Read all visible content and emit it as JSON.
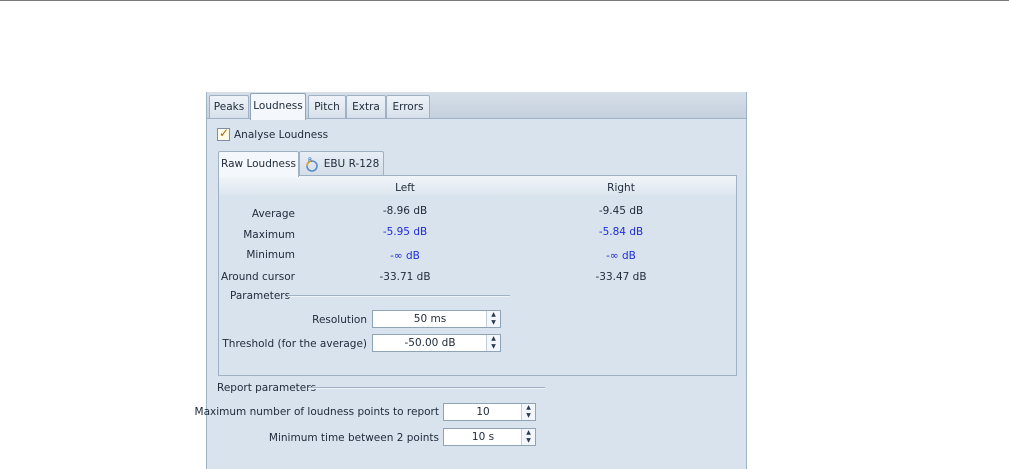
{
  "tabs": [
    "Peaks",
    "Loudness",
    "Pitch",
    "Extra",
    "Errors"
  ],
  "analyse": {
    "label": "Analyse Loudness",
    "checked": true
  },
  "subtabs": {
    "raw": "Raw Loudness",
    "ebu": "EBU R-128"
  },
  "columns": {
    "left": "Left",
    "right": "Right"
  },
  "rows": {
    "average": {
      "label": "Average",
      "left": "-8.96 dB",
      "right": "-9.45 dB"
    },
    "maximum": {
      "label": "Maximum",
      "left": "-5.95 dB",
      "right": "-5.84 dB"
    },
    "minimum": {
      "label": "Minimum",
      "left": "-∞ dB",
      "right": "-∞ dB"
    },
    "cursor": {
      "label": "Around cursor",
      "left": "-33.71 dB",
      "right": "-33.47 dB"
    }
  },
  "parameters": {
    "title": "Parameters",
    "resolution": {
      "label": "Resolution",
      "value": "50 ms"
    },
    "threshold": {
      "label": "Threshold (for the average)",
      "value": "-50.00 dB"
    }
  },
  "report": {
    "title": "Report parameters",
    "max_points": {
      "label": "Maximum number of loudness points to report",
      "value": "10"
    },
    "min_time": {
      "label": "Minimum time between 2 points",
      "value": "10 s"
    }
  },
  "colors": {
    "blue_value": "#1f2cd6",
    "panel_bg": "#d8e3ee",
    "tab_active": "#f4f7fb"
  }
}
